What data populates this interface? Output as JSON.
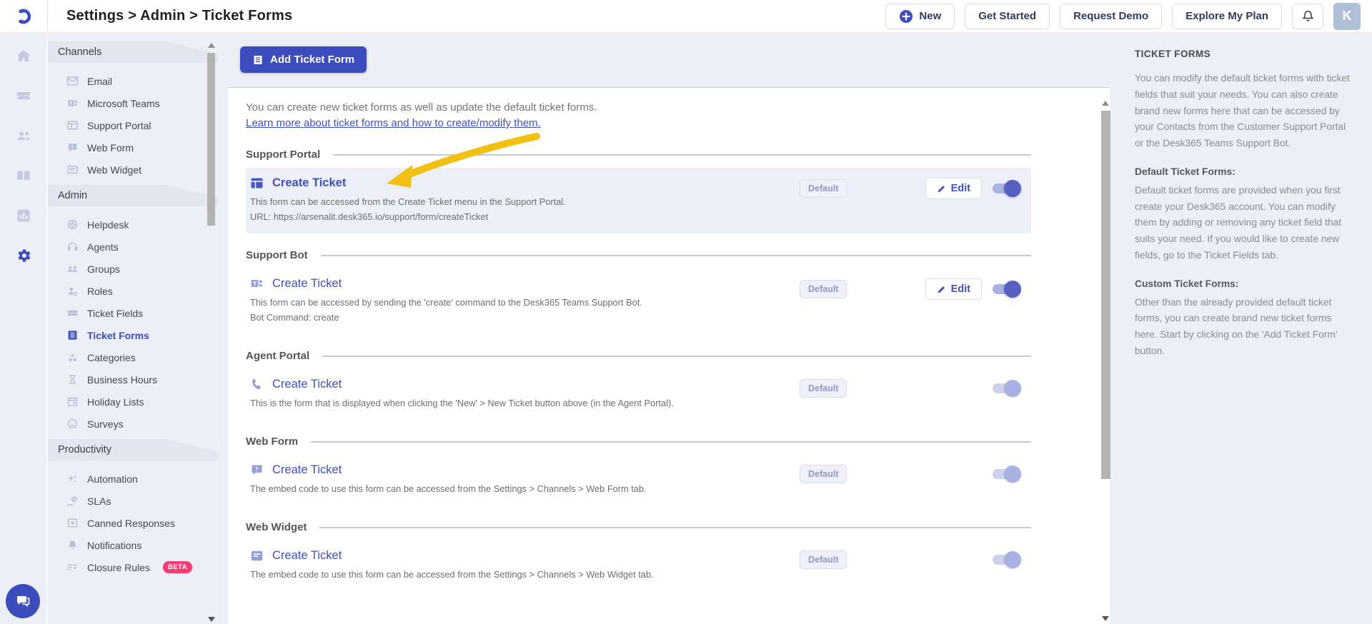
{
  "header": {
    "breadcrumb": "Settings > Admin > Ticket Forms",
    "new_button": "New",
    "get_started_button": "Get Started",
    "request_demo_button": "Request Demo",
    "explore_plan_button": "Explore My Plan",
    "avatar_initial": "K"
  },
  "sidebar": {
    "sections": [
      {
        "label": "Channels",
        "items": [
          {
            "label": "Email",
            "icon": "email-icon"
          },
          {
            "label": "Microsoft Teams",
            "icon": "teams-icon"
          },
          {
            "label": "Support Portal",
            "icon": "browser-window-icon"
          },
          {
            "label": "Web Form",
            "icon": "chat-bubble-icon"
          },
          {
            "label": "Web Widget",
            "icon": "widget-window-icon"
          }
        ]
      },
      {
        "label": "Admin",
        "items": [
          {
            "label": "Helpdesk",
            "icon": "lifebuoy-icon"
          },
          {
            "label": "Agents",
            "icon": "headset-icon"
          },
          {
            "label": "Groups",
            "icon": "people-icon"
          },
          {
            "label": "Roles",
            "icon": "person-gear-icon"
          },
          {
            "label": "Ticket Fields",
            "icon": "ticket-icon"
          },
          {
            "label": "Ticket Forms",
            "icon": "form-icon",
            "active": true
          },
          {
            "label": "Categories",
            "icon": "shapes-icon"
          },
          {
            "label": "Business Hours",
            "icon": "hourglass-icon"
          },
          {
            "label": "Holiday Lists",
            "icon": "calendar-icon"
          },
          {
            "label": "Surveys",
            "icon": "smiley-icon"
          }
        ]
      },
      {
        "label": "Productivity",
        "items": [
          {
            "label": "Automation",
            "icon": "sparkles-icon"
          },
          {
            "label": "SLAs",
            "icon": "gavel-icon"
          },
          {
            "label": "Canned Responses",
            "icon": "box-plus-icon"
          },
          {
            "label": "Notifications",
            "icon": "bell-icon"
          },
          {
            "label": "Closure Rules",
            "icon": "checklist-icon",
            "badge": "BETA"
          }
        ]
      }
    ]
  },
  "toolbar": {
    "add_ticket_form_label": "Add Ticket Form"
  },
  "content": {
    "intro_text": "You can create new ticket forms as well as update the default ticket forms.",
    "intro_link": "Learn more about ticket forms and how to create/modify them.",
    "sections": [
      {
        "heading": "Support Portal",
        "form_title": "Create Ticket",
        "line1": "This form can be accessed from the Create Ticket menu in the Support Portal.",
        "line2": "URL: https://arsenalit.desk365.io/support/form/createTicket",
        "badge": "Default",
        "edit_label": "Edit",
        "toggle_enabled": true,
        "highlighted": true
      },
      {
        "heading": "Support Bot",
        "form_title": "Create Ticket",
        "line1": "This form can be accessed by sending the 'create' command to the Desk365 Teams Support Bot.",
        "line2": "Bot Command: create",
        "badge": "Default",
        "edit_label": "Edit",
        "toggle_enabled": true
      },
      {
        "heading": "Agent Portal",
        "form_title": "Create Ticket",
        "line1": "This is the form that is displayed when clicking the 'New' > New Ticket button above (in the Agent Portal).",
        "badge": "Default",
        "toggle_enabled": false
      },
      {
        "heading": "Web Form",
        "form_title": "Create Ticket",
        "line1": "The embed code to use this form can be accessed from the Settings > Channels > Web Form tab.",
        "badge": "Default",
        "toggle_enabled": false
      },
      {
        "heading": "Web Widget",
        "form_title": "Create Ticket",
        "line1": "The embed code to use this form can be accessed from the Settings > Channels > Web Widget tab.",
        "badge": "Default",
        "toggle_enabled": false
      }
    ]
  },
  "help_panel": {
    "title": "TICKET FORMS",
    "intro": "You can modify the default ticket forms with ticket fields that suit your needs. You can also create brand new forms here that can be accessed by your Contacts from the Customer Support Portal or the Desk365 Teams Support Bot.",
    "default_heading": "Default Ticket Forms:",
    "default_body": "Default ticket forms are provided when you first create your Desk365 account. You can modify them by adding or removing any ticket field that suits your need. If you would like to create new fields, go to the Ticket Fields tab.",
    "custom_heading": "Custom Ticket Forms:",
    "custom_body": "Other than the already provided default ticket forms, you can create brand new ticket forms here. Start by clicking on the 'Add Ticket Form' button."
  },
  "colors": {
    "primary": "#3C4CBC",
    "link": "#3F51B5",
    "beta_badge": "#F43F74",
    "annotation_arrow": "#F1C013",
    "toggle_on_knob": "#5560C1",
    "toggle_on_track": "#A8B1E2",
    "avatar_bg": "#AEBFD6",
    "sidebar_bg": "#EDEFF6"
  }
}
